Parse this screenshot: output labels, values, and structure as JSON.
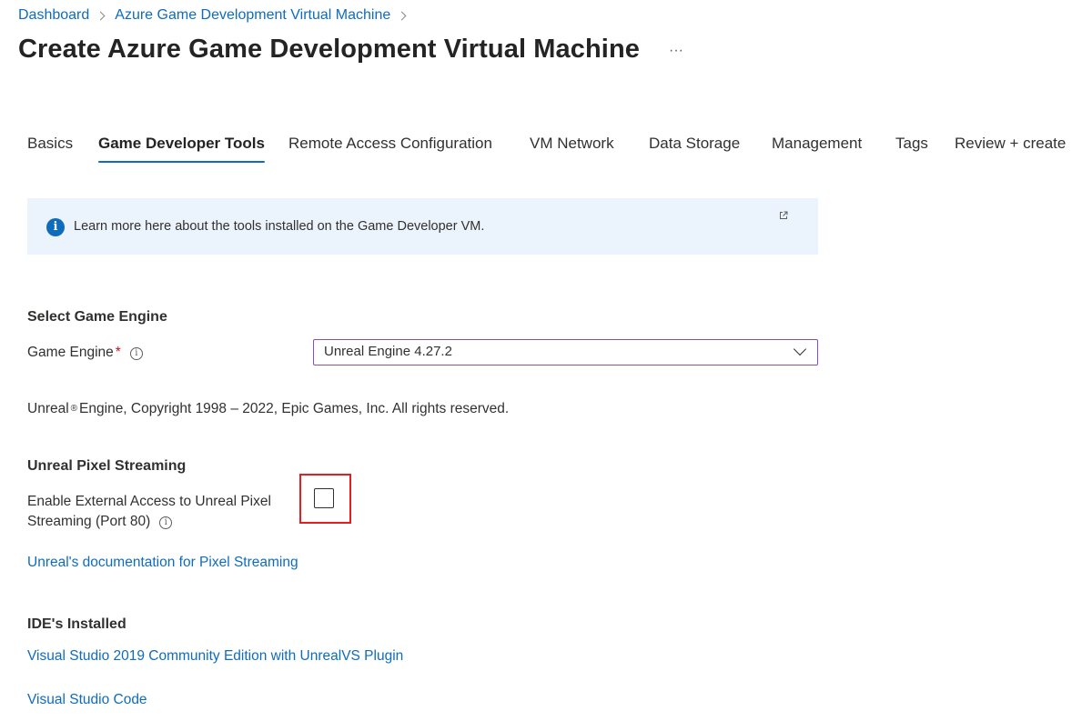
{
  "breadcrumb": {
    "items": [
      "Dashboard",
      "Azure Game Development Virtual Machine"
    ]
  },
  "header": {
    "title": "Create Azure Game Development Virtual Machine",
    "more_label": "···"
  },
  "tabs": [
    {
      "label": "Basics",
      "active": false
    },
    {
      "label": "Game Developer Tools",
      "active": true
    },
    {
      "label": "Remote Access Configuration",
      "active": false
    },
    {
      "label": "VM Network",
      "active": false
    },
    {
      "label": "Data Storage",
      "active": false
    },
    {
      "label": "Management",
      "active": false
    },
    {
      "label": "Tags",
      "active": false
    },
    {
      "label": "Review + create",
      "active": false
    }
  ],
  "info_banner": {
    "text": "Learn more here about the tools installed on the Game Developer VM.",
    "icon": "info-icon",
    "link_icon": "external-link-icon"
  },
  "game_engine_section": {
    "heading": "Select Game Engine",
    "field_label": "Game Engine",
    "required_mark": "*",
    "info_glyph": "i",
    "selected_value": "Unreal Engine 4.27.2",
    "copyright_prefix": "Unreal",
    "copyright_symbol": "®",
    "copyright_rest": "Engine, Copyright 1998 – 2022, Epic Games, Inc. All rights reserved."
  },
  "pixel_streaming_section": {
    "heading": "Unreal Pixel Streaming",
    "checkbox_label_line1": "Enable External Access to Unreal Pixel",
    "checkbox_label_line2": "Streaming (Port 80)",
    "info_glyph": "i",
    "checked": false,
    "doc_link": "Unreal's documentation for Pixel Streaming"
  },
  "ide_section": {
    "heading": "IDE's Installed",
    "links": [
      "Visual Studio 2019 Community Edition with UnrealVS Plugin",
      "Visual Studio Code"
    ]
  },
  "colors": {
    "accent": "#0f6cbd",
    "banner_bg": "#ebf3fc",
    "select_border": "#8a4bc6",
    "highlight": "#e81e1e",
    "required": "#c50f1f"
  }
}
